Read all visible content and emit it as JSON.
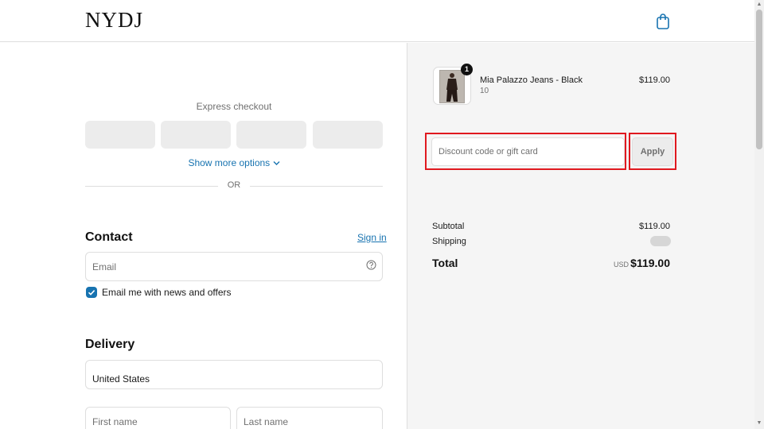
{
  "header": {
    "logo": "NYDJ",
    "cart_icon": "shopping-bag-icon"
  },
  "express": {
    "title": "Express checkout",
    "show_more": "Show more options",
    "show_more_icon": "chevron-down-icon",
    "divider": "OR"
  },
  "contact": {
    "title": "Contact",
    "sign_in": "Sign in",
    "email_placeholder": "Email",
    "help_icon": "question-circle-icon",
    "newsletter_label": "Email me with news and offers",
    "newsletter_checked": true
  },
  "delivery": {
    "title": "Delivery",
    "country": "United States",
    "first_name_placeholder": "First name",
    "last_name_placeholder": "Last name"
  },
  "order": {
    "quantity": "1",
    "product_name": "Mia Palazzo Jeans - Black",
    "variant": "10",
    "price": "$119.00",
    "discount_placeholder": "Discount code or gift card",
    "apply_label": "Apply",
    "subtotal_label": "Subtotal",
    "subtotal_value": "$119.00",
    "shipping_label": "Shipping",
    "total_label": "Total",
    "currency": "USD",
    "total_value": "$119.00"
  },
  "colors": {
    "accent": "#1773b0",
    "highlight": "#e0191f",
    "summary_bg": "#f5f5f5"
  }
}
